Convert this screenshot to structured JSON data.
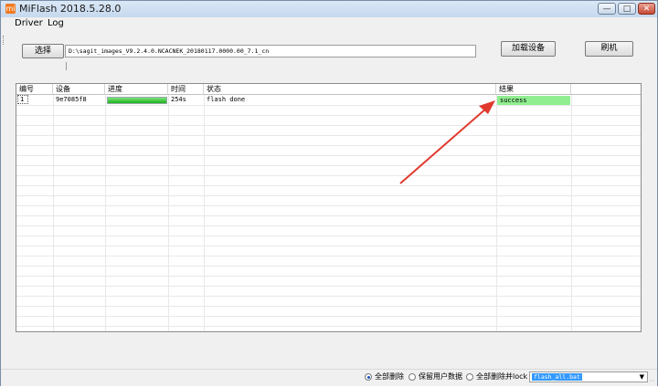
{
  "window": {
    "title": "MiFlash 2018.5.28.0",
    "icon_text": "mi"
  },
  "menu": {
    "items": [
      "Driver",
      "Log"
    ]
  },
  "toolbar": {
    "select_label": "选择",
    "path_value": "D:\\sagit_images_V9.2.4.0.NCACNEK_20180117.0000.00_7.1_cn",
    "load_devices_label": "加载设备",
    "flash_label": "刷机"
  },
  "table": {
    "columns": [
      "编号",
      "设备",
      "进度",
      "时间",
      "状态",
      "结果"
    ],
    "rows": [
      {
        "index": "1",
        "device": "9e7085f8",
        "progress": 1.0,
        "time": "254s",
        "status": "flash done",
        "result": "success"
      }
    ]
  },
  "footer": {
    "options": [
      "全部删除",
      "保留用户数据",
      "全部删除并lock"
    ],
    "selected_option": "全部删除",
    "script_value": "flash_all.bat"
  },
  "colors": {
    "success_bg": "#90ee90",
    "progress": "#1bb21b",
    "annotation_arrow": "#e03a2f"
  }
}
